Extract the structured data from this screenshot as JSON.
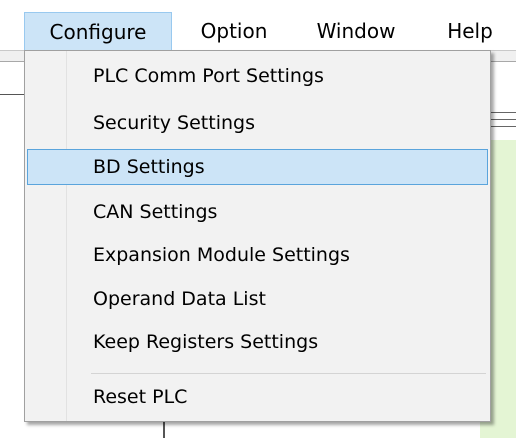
{
  "menubar": {
    "items": [
      {
        "label": "Configure",
        "active": true
      },
      {
        "label": "Option",
        "active": false
      },
      {
        "label": "Window",
        "active": false
      },
      {
        "label": "Help",
        "active": false
      }
    ]
  },
  "dropdown": {
    "items": [
      {
        "label": "PLC Comm Port Settings"
      },
      {
        "label": "Security Settings"
      },
      {
        "label": "BD Settings",
        "highlighted": true
      },
      {
        "label": "CAN Settings"
      },
      {
        "label": "Expansion Module Settings"
      },
      {
        "label": "Operand Data List"
      },
      {
        "label": "Keep Registers Settings"
      },
      {
        "label": "Reset PLC"
      }
    ]
  },
  "colors": {
    "highlight_bg": "#cce4f7",
    "highlight_border": "#5aa4dc",
    "menu_bg": "#f2f2f2",
    "panel_green": "#e4f5d4"
  }
}
